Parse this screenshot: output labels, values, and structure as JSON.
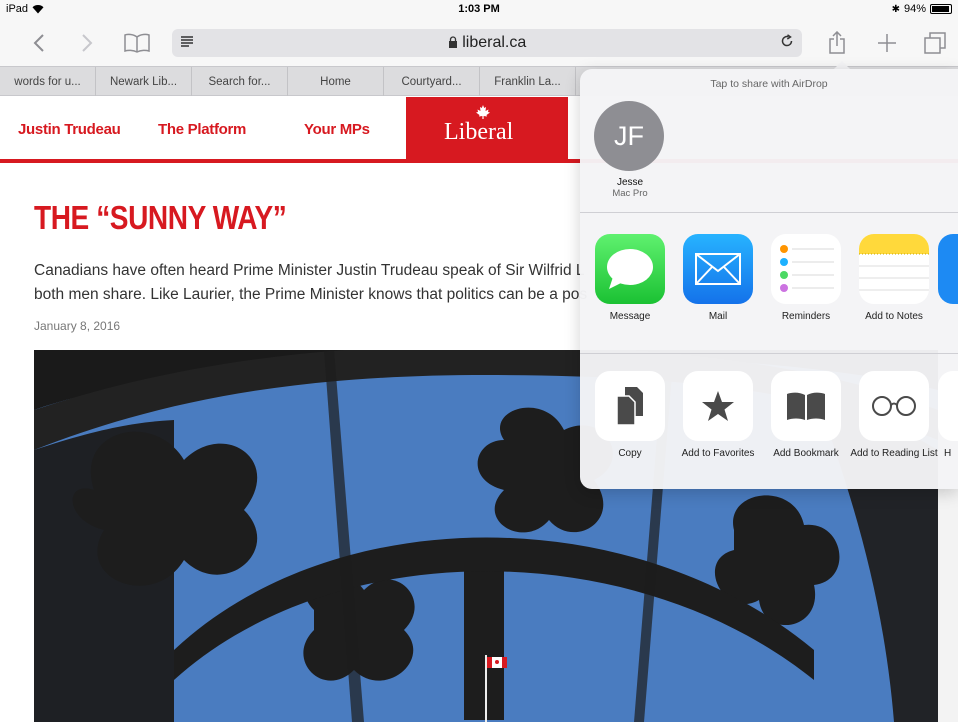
{
  "status": {
    "device": "iPad",
    "time": "1:03 PM",
    "battery": "94%",
    "battery_level": 0.94
  },
  "address": {
    "url": "liberal.ca"
  },
  "tabs": [
    "words for u...",
    "Newark Lib...",
    "Search for...",
    "Home",
    "Courtyard...",
    "Franklin La..."
  ],
  "site": {
    "nav": [
      "Justin Trudeau",
      "The Platform",
      "Your MPs"
    ],
    "logo": "Liberal"
  },
  "article": {
    "headline": "THE “SUNNY WAY”",
    "line1": "Canadians have often heard Prime Minister Justin Trudeau speak of Sir Wilfrid L",
    "line2": "both men share. Like Laurier, the Prime Minister knows that politics can be a pos",
    "date": "January 8, 2016"
  },
  "share": {
    "airdrop_hint": "Tap to share with AirDrop",
    "person": {
      "initials": "JF",
      "name": "Jesse",
      "device": "Mac Pro"
    },
    "apps": [
      "Message",
      "Mail",
      "Reminders",
      "Add to Notes"
    ],
    "actions": [
      "Copy",
      "Add to Favorites",
      "Add Bookmark",
      "Add to Reading List",
      "H"
    ]
  },
  "colors": {
    "brand_red": "#d71920",
    "sky_blue": "#4c7fbe"
  }
}
